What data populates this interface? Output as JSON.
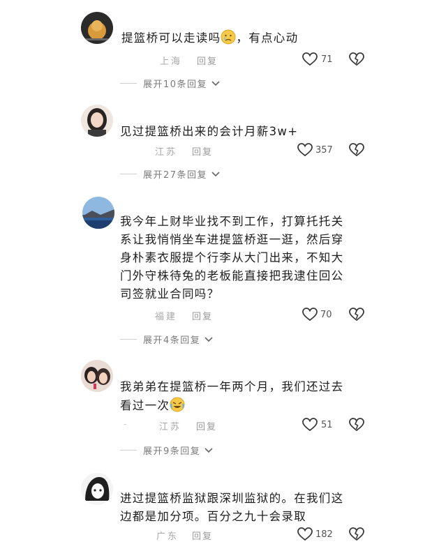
{
  "comments": [
    {
      "text": "提篮桥可以走读吗",
      "text_suffix": "，有点心动",
      "emoji": "crying-face",
      "location": "上海",
      "reply_label": "回复",
      "likes": "71",
      "expand_label": "展开10条回复"
    },
    {
      "text": "见过提篮桥出来的会计月薪3w+",
      "location": "江苏",
      "reply_label": "回复",
      "likes": "357",
      "expand_label": "展开27条回复"
    },
    {
      "text_lines": [
        "我今年上财毕业找不到工作，打算托托关",
        "系让我悄悄坐车进提篮桥逛一逛，然后穿",
        "身朴素衣服提个行李从大门出来，不知大",
        "门外守株待兔的老板能直接把我逮住回公",
        "司签就业合同吗？"
      ],
      "location": "福建",
      "reply_label": "回复",
      "likes": "70",
      "expand_label": "展开4条回复"
    },
    {
      "text_lines": [
        "我弟弟在提篮桥一年两个月，我们还过去",
        "看过一次"
      ],
      "emoji": "rofl-face",
      "location": "江苏",
      "reply_label": "回复",
      "likes": "51",
      "expand_label": "展开9条回复"
    },
    {
      "text_lines": [
        "进过提篮桥监狱跟深圳监狱的。在我们这",
        "边都是加分项。百分之九十会录取"
      ],
      "location": "广东",
      "reply_label": "回复",
      "likes": "182"
    }
  ]
}
